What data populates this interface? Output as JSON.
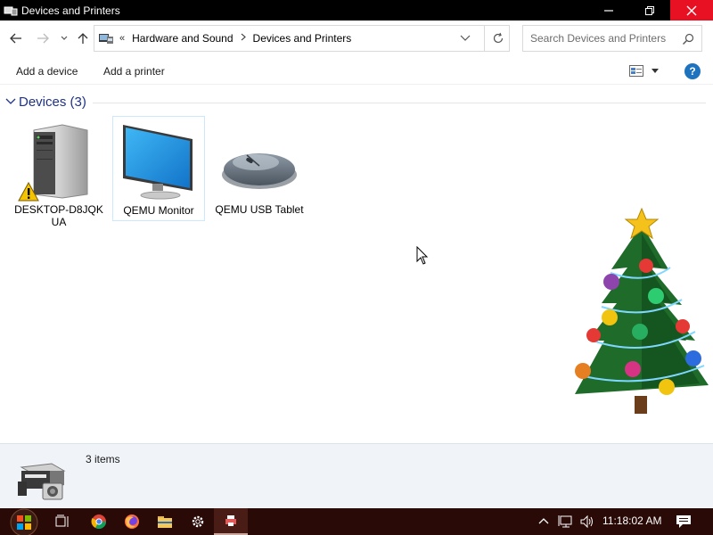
{
  "window": {
    "title": "Devices and Printers"
  },
  "address": {
    "overflow": "«",
    "crumbs": [
      "Hardware and Sound",
      "Devices and Printers"
    ],
    "search_placeholder": "Search Devices and Printers"
  },
  "commands": {
    "add_device": "Add a device",
    "add_printer": "Add a printer",
    "help": "?"
  },
  "group": {
    "label": "Devices (3)"
  },
  "devices": [
    {
      "name": "DESKTOP-D8JQK UA",
      "line1": "DESKTOP-D8JQK",
      "line2": "UA",
      "icon": "computer-tower-icon",
      "warning": true
    },
    {
      "name": "QEMU Monitor",
      "icon": "monitor-icon",
      "selected": true
    },
    {
      "name": "QEMU USB Tablet",
      "icon": "mouse-icon"
    }
  ],
  "status": {
    "count": "3 items"
  },
  "taskbar": {
    "clock": "11:18:02 AM",
    "items": [
      "start-icon",
      "task-view-icon",
      "chrome-icon",
      "firefox-icon",
      "file-explorer-icon",
      "settings-icon",
      "devices-printers-icon"
    ]
  },
  "colors": {
    "titlebar": "#000000",
    "close_button": "#e81123",
    "group_label": "#1e3287",
    "taskbar": "#2a0a07",
    "selection_border": "#cce8ff"
  }
}
